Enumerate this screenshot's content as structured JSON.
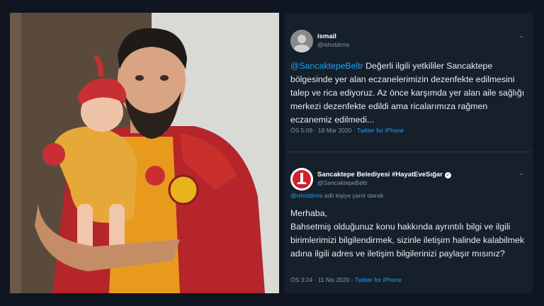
{
  "photo": {
    "alt_kind": "man-holding-baby-photo"
  },
  "tweet1": {
    "name": "ismail",
    "handle": "@ishotdrms",
    "mention": "@SancaktepeBeltr",
    "text": " Değerli ilgili yetkililer Sancaktepe bölgesinde yer alan eczanelerimizin dezenfekte edilmesini talep ve rica ediyoruz. Az önce karşımda yer alan aile sağlığı merkezi dezenfekte edildi ama ricalarımıza rağmen eczanemiz edilmedi...",
    "time": "ÖS 5:09",
    "sep": " · ",
    "date": "18 Mar 2020",
    "source": "Twitter for iPhone"
  },
  "tweet2": {
    "name": "Sancaktepe Belediyesi #HayatEveSığar",
    "handle": "@SancaktepeBeltr",
    "reply_mention": "@ishotdrms",
    "reply_suffix": " adlı kişiye yanıt olarak",
    "line1": "Merhaba,",
    "text": "Bahsetmiş olduğunuz konu hakkında ayrıntılı bilgi ve ilgili birimlerimizi bilgilendirmek, sizinle iletişim halinde kalabilmek adına ilgili adres ve iletişim bilgilerinizi paylaşır mısınız?",
    "time": "ÖS 3:24",
    "sep": " · ",
    "date": "11 Nis 2020",
    "source": "Twitter for iPhone"
  },
  "icons": {
    "chevron": "chevron-down-icon",
    "verified": "verified-badge-icon"
  }
}
